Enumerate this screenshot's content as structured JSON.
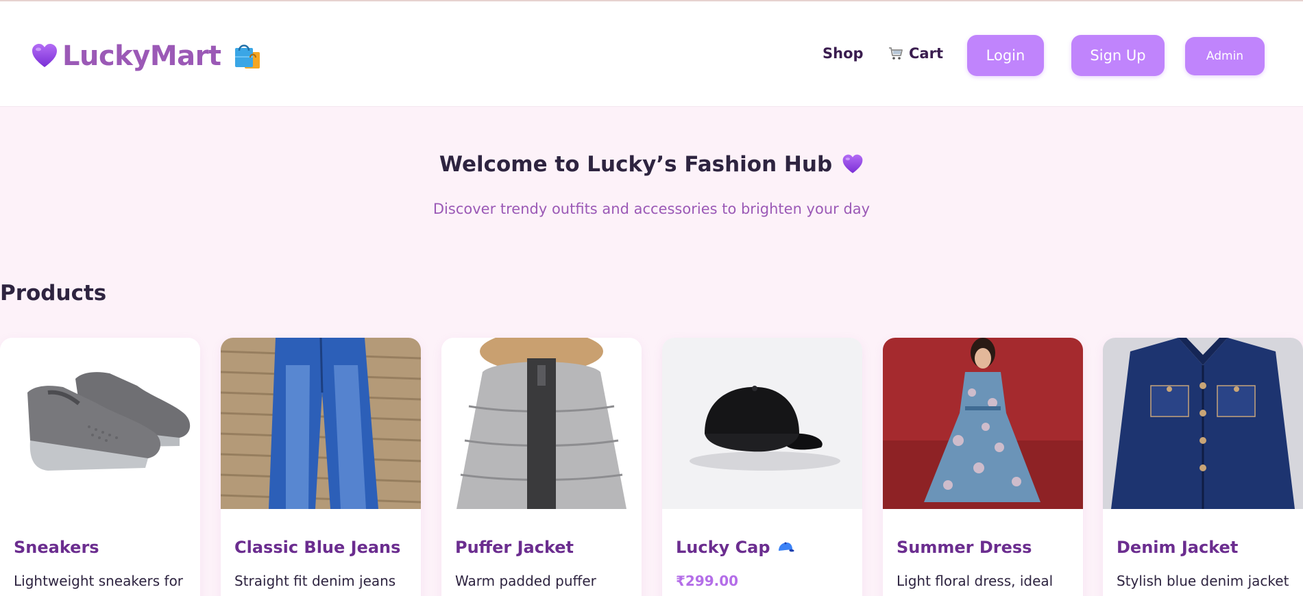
{
  "brand": {
    "name": "LuckyMart",
    "accent": "#9b59b6",
    "button_color": "#c084fc"
  },
  "nav": {
    "shop_label": "Shop",
    "cart_label": "Cart",
    "login_label": "Login",
    "signup_label": "Sign Up",
    "admin_label": "Admin"
  },
  "hero": {
    "title": "Welcome to Lucky’s Fashion Hub",
    "subtitle": "Discover trendy outfits and accessories to brighten your day"
  },
  "products_section": {
    "title": "Products",
    "items": [
      {
        "name": "Sneakers",
        "description": "Lightweight sneakers for",
        "icon": "sneaker-image"
      },
      {
        "name": "Classic Blue Jeans",
        "description": "Straight fit denim jeans",
        "icon": "jeans-image"
      },
      {
        "name": "Puffer Jacket",
        "description": "Warm padded puffer",
        "icon": "puffer-jacket-image"
      },
      {
        "name": "Lucky Cap",
        "price": "₹299.00",
        "icon": "cap-image"
      },
      {
        "name": "Summer Dress",
        "description": "Light floral dress, ideal",
        "icon": "summer-dress-image"
      },
      {
        "name": "Denim Jacket",
        "description": "Stylish blue denim jacket",
        "icon": "denim-jacket-image"
      }
    ]
  }
}
